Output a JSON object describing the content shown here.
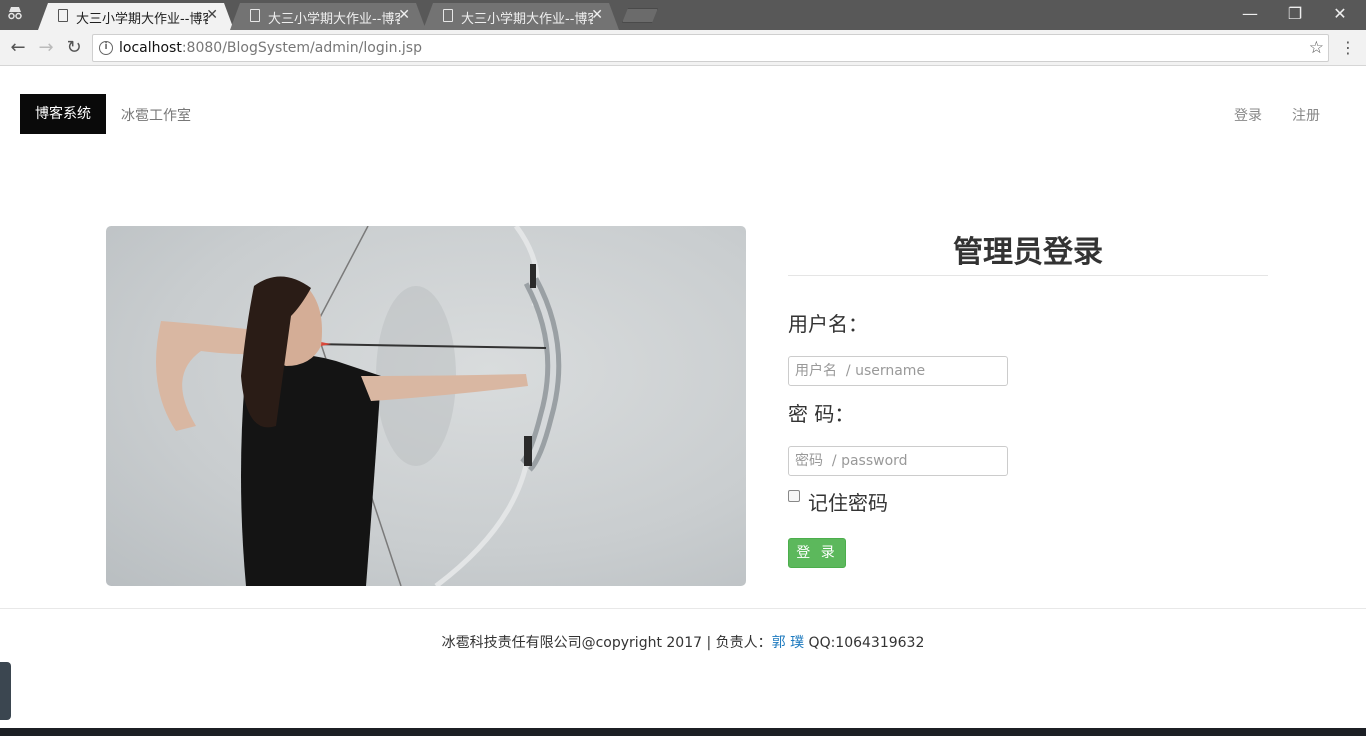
{
  "browser": {
    "tabs": [
      {
        "title": "大三小学期大作业--博客系统",
        "active": true
      },
      {
        "title": "大三小学期大作业--博客系统",
        "active": false
      },
      {
        "title": "大三小学期大作业--博客系统",
        "active": false
      }
    ],
    "url_host": "localhost",
    "url_rest": ":8080/BlogSystem/admin/login.jsp"
  },
  "navbar": {
    "brand": "博客系统",
    "studio": "冰雹工作室",
    "login": "登录",
    "register": "注册"
  },
  "form": {
    "title": "管理员登录",
    "username_label": "用户名：",
    "username_placeholder": "用户名  / username",
    "password_label": "密  码：",
    "password_placeholder": "密码  / password",
    "remember_label": "记住密码",
    "submit_label": "登 录"
  },
  "footer": {
    "text_before": "冰雹科技责任有限公司@copyright 2017 | 负责人：",
    "owner": "郭 璞",
    "text_after": " QQ:1064319632"
  }
}
